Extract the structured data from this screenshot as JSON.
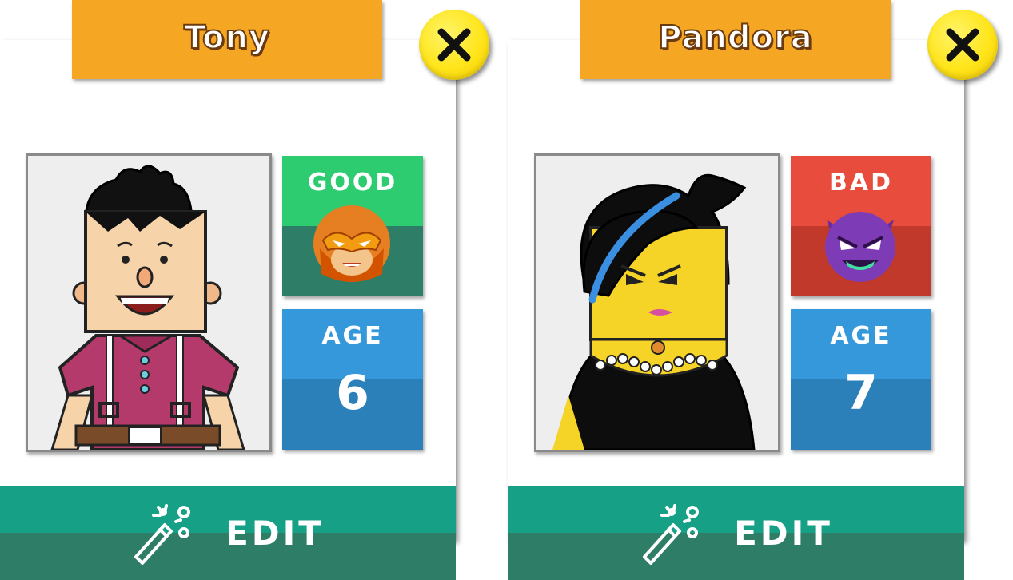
{
  "cards": [
    {
      "name": "Tony",
      "close_icon": "close-x-icon",
      "portrait": "boy-character-portrait",
      "alignment": {
        "label": "GOOD",
        "icon": "hero-mask-icon",
        "top_color": "#2ecc71",
        "bottom_color": "#2e7d66"
      },
      "age": {
        "label": "AGE",
        "value": "6",
        "top_color": "#3498db",
        "bottom_color": "#2b80b9"
      },
      "edit": {
        "label": "EDIT",
        "icon": "magic-wand-icon"
      }
    },
    {
      "name": "Pandora",
      "close_icon": "close-x-icon",
      "portrait": "girl-character-portrait",
      "alignment": {
        "label": "BAD",
        "icon": "devil-face-icon",
        "top_color": "#e74c3c",
        "bottom_color": "#c0392b"
      },
      "age": {
        "label": "AGE",
        "value": "7",
        "top_color": "#3498db",
        "bottom_color": "#2b80b9"
      },
      "edit": {
        "label": "EDIT",
        "icon": "magic-wand-icon"
      }
    }
  ],
  "colors": {
    "name_tab": "#f5a623",
    "close_button": "#ffe51a",
    "edit_top": "#16a085",
    "edit_bottom": "#2e7d66"
  }
}
